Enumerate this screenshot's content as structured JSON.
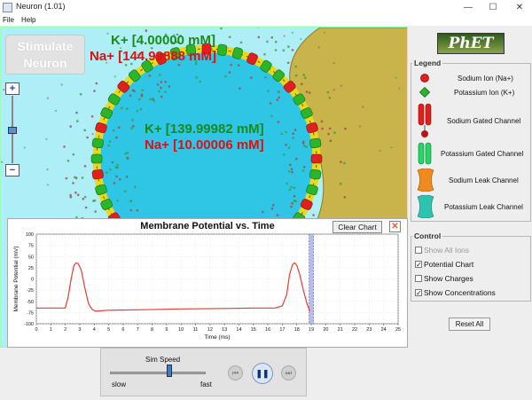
{
  "window": {
    "title": "Neuron (1.01)",
    "minimize": "—",
    "maximize": "☐",
    "close": "✕"
  },
  "menu": {
    "items": [
      "File",
      "Help"
    ]
  },
  "sim": {
    "stimulate_label_line1": "Stimulate",
    "stimulate_label_line2": "Neuron",
    "zoom_in": "+",
    "zoom_out": "−",
    "outside": {
      "k": "K+ [4.00000 mM]",
      "na": "Na+ [144.99888 mM]"
    },
    "inside": {
      "k": "K+ [139.99982 mM]",
      "na": "Na+ [10.00006 mM]"
    }
  },
  "chart": {
    "title": "Membrane Potential vs. Time",
    "clear_label": "Clear Chart",
    "close": "✕"
  },
  "chart_data": {
    "type": "line",
    "title": "Membrane Potential vs. Time",
    "xlabel": "Time (ms)",
    "ylabel": "Membrane Potential (mV)",
    "xlim": [
      0,
      25
    ],
    "ylim": [
      -100,
      100
    ],
    "x_ticks": [
      0,
      1,
      2,
      3,
      4,
      5,
      6,
      7,
      8,
      9,
      10,
      11,
      12,
      13,
      14,
      15,
      16,
      17,
      18,
      19,
      20,
      21,
      22,
      23,
      24,
      25
    ],
    "y_ticks": [
      100,
      75,
      50,
      25,
      0,
      -25,
      -50,
      -75,
      -100
    ],
    "cursor_x": 19,
    "series": [
      {
        "color": "#e53a3a",
        "x": [
          0,
          2.0,
          2.2,
          2.4,
          2.6,
          2.75,
          2.9,
          3.1,
          3.35,
          3.6,
          3.85,
          4.1,
          4.5,
          5,
          7,
          10,
          13,
          15,
          16.5,
          17.0,
          17.3,
          17.5,
          17.7,
          17.85,
          18.0,
          18.2,
          18.45,
          18.7,
          18.9
        ],
        "y": [
          -65,
          -65,
          -40,
          0,
          30,
          36,
          34,
          20,
          -20,
          -55,
          -68,
          -72,
          -71,
          -70,
          -69,
          -67,
          -66,
          -65,
          -65,
          -60,
          -35,
          10,
          32,
          36,
          30,
          10,
          -25,
          -55,
          -72
        ]
      }
    ]
  },
  "legend": {
    "title": "Legend",
    "items": [
      {
        "label": "Sodium Ion (Na+)",
        "icon": "sodium-ion-icon",
        "color": "#e02020"
      },
      {
        "label": "Potassium Ion (K+)",
        "icon": "potassium-ion-icon",
        "color": "#2ab52a"
      },
      {
        "label": "Sodium Gated Channel",
        "icon": "sodium-gated-channel-icon",
        "color": "#e02020"
      },
      {
        "label": "Potassium Gated Channel",
        "icon": "potassium-gated-channel-icon",
        "color": "#27d46a"
      },
      {
        "label": "Sodium Leak Channel",
        "icon": "sodium-leak-channel-icon",
        "color": "#f08a1c"
      },
      {
        "label": "Potassium Leak Channel",
        "icon": "potassium-leak-channel-icon",
        "color": "#2cc4b0"
      }
    ]
  },
  "control": {
    "title": "Control",
    "options": [
      {
        "label": "Show All Ions",
        "checked": false,
        "disabled": true
      },
      {
        "label": "Potential Chart",
        "checked": true,
        "disabled": false
      },
      {
        "label": "Show Charges",
        "checked": false,
        "disabled": false
      },
      {
        "label": "Show Concentrations",
        "checked": true,
        "disabled": false
      }
    ],
    "reset_label": "Reset All"
  },
  "clock": {
    "speed_label": "Sim Speed",
    "slow_label": "slow",
    "fast_label": "fast",
    "rewind": "⏮",
    "pause": "❚❚",
    "step": "⏭"
  },
  "logo_text": "PhET"
}
